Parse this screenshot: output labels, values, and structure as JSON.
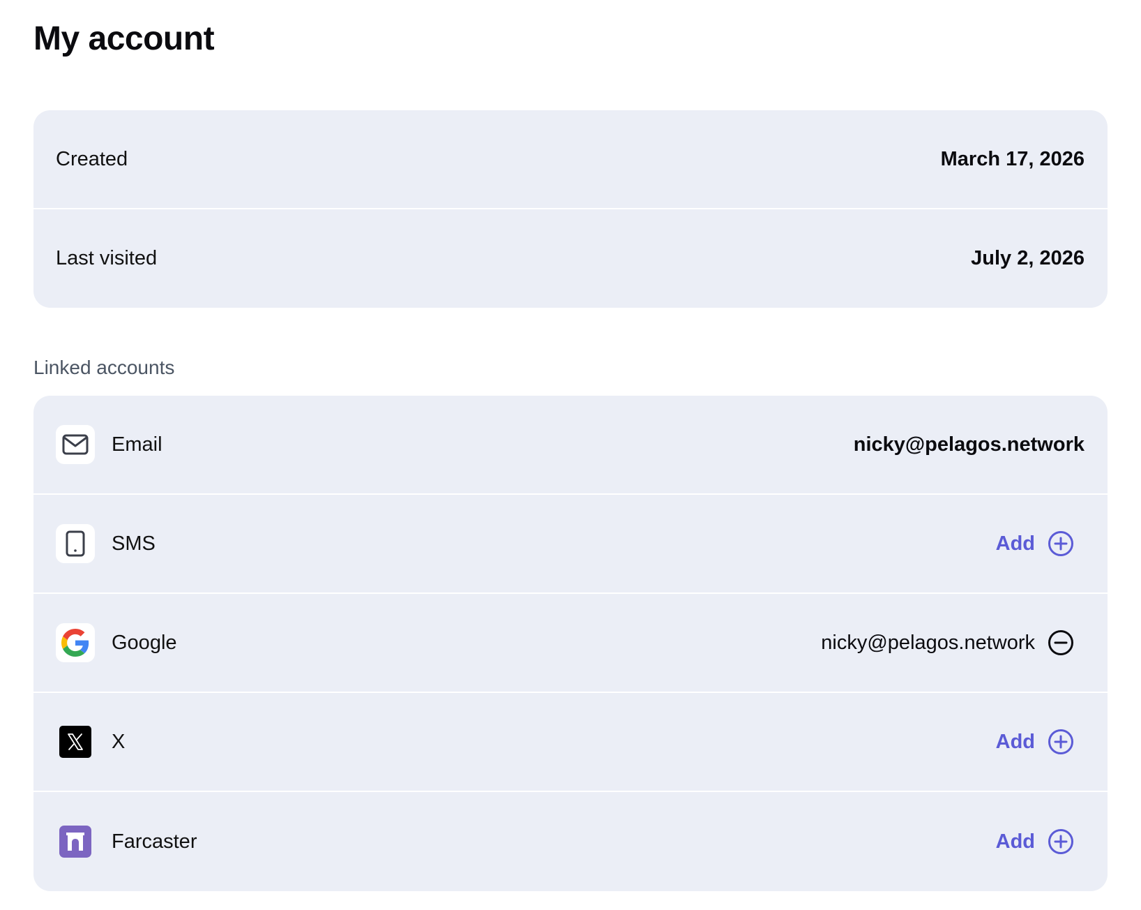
{
  "page": {
    "title": "My account"
  },
  "info": {
    "rows": [
      {
        "label": "Created",
        "value": "March 17, 2026"
      },
      {
        "label": "Last visited",
        "value": "July 2, 2026"
      }
    ]
  },
  "linked": {
    "section_label": "Linked accounts",
    "add_label": "Add",
    "accounts": [
      {
        "name": "Email",
        "icon": "mail-icon",
        "value": "nicky@pelagos.network"
      },
      {
        "name": "SMS",
        "icon": "phone-icon"
      },
      {
        "name": "Google",
        "icon": "google-icon",
        "value": "nicky@pelagos.network"
      },
      {
        "name": "X",
        "icon": "x-logo-icon"
      },
      {
        "name": "Farcaster",
        "icon": "farcaster-icon"
      }
    ]
  },
  "colors": {
    "accent": "#5b5bd6",
    "card_bg": "#ebeef6",
    "farcaster": "#7c65c1"
  }
}
